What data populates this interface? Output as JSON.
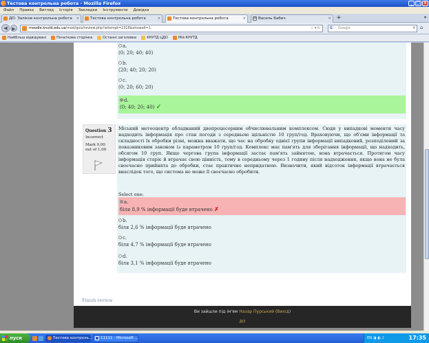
{
  "window": {
    "title": "Тестова контрольна робота - Mozilla Firefox"
  },
  "menu": [
    "Файл",
    "Правка",
    "Вигляд",
    "Історія",
    "Закладки",
    "Інструменти",
    "Довідка"
  ],
  "tabs": [
    {
      "label": "ДО: Заліков контрольна робота"
    },
    {
      "label": "Тестова контрольна робота"
    },
    {
      "label": "Тестова контрольна робота"
    },
    {
      "label": "Василь Бабич"
    }
  ],
  "nav": {
    "url_domain": "moodle.knutd.edu.ua",
    "url_path": "/mod/quiz/review.php?attempt=2316&showall=1",
    "search_placeholder": "Google",
    "search_engine": "G"
  },
  "bookmarks": [
    "Найбільш відвідувані",
    "Початкова сторінка",
    "Останні заголовки",
    "КНУТД ЦДО",
    "Мій КНУТД"
  ],
  "prev_question": {
    "options": [
      {
        "letter": "a.",
        "text": "(0; 20; 40; 40)"
      },
      {
        "letter": "b.",
        "text": "(20; 40; 20; 20)"
      },
      {
        "letter": "c.",
        "text": "(0; 20; 60; 20)"
      },
      {
        "letter": "d.",
        "text": "(0; 40; 20; 40)"
      }
    ]
  },
  "question": {
    "label": "Question",
    "number": "3",
    "state": "Incorrect",
    "mark_line1": "Mark 0,00",
    "mark_line2": "out of 1,00",
    "text": "Міський метеоцентр обладнаний двопроцесорним обчислювальним комплексом. Сюди у випадкові моменти часу надходить інформація про стан погоди з середньою щільністю 10 груп/год. Враховуючи, що об'єми інформації та складності їх обробки різні, можна вважати, що час на обробку однієї групи інформації випадковий, розподілений за показниковим законом із параметром 10 груп/год. Комплекс має пам'ять для зберігання інформації, що надходить, обсягом 10 груп. Якщо чергова група інформації застає пам'ять зайнятою, вона втрачається. Протягом часу інформація старіє й втрачає свою цінність, тому в середньому через 1 годину після надходження, якщо вона не була своєчасно прийнята до обробки, стає практично непридатною. Визначити, який відсоток інформації втрачається внаслідок того, що система не може її своєчасно обробити.",
    "select_label": "Select one:",
    "options": [
      {
        "letter": "a.",
        "text": "біля 8,9 % інформації буде втрачено"
      },
      {
        "letter": "b.",
        "text": "біля 2,6 % інформації буде втрачено"
      },
      {
        "letter": "c.",
        "text": "біля 4,7 % інформації буде втрачено"
      },
      {
        "letter": "d.",
        "text": "біля 3,1 % інформації буде втрачено"
      }
    ]
  },
  "finish_link": "Finish review",
  "footer": {
    "login_prefix": "Ви зайшли під ім'ям",
    "user": "Назар Пурський",
    "logout": "Вихід",
    "home": "ДО"
  },
  "taskbar": {
    "start": "пуск",
    "tasks": [
      "Тестова контроль...",
      "11111 - Microsoft ..."
    ],
    "lang": "EN",
    "clock": "17:35"
  },
  "colors": {
    "correct": "#a8f59a",
    "wrong": "#f7b3b3",
    "panel": "#e7f3f5",
    "footer": "#262626"
  }
}
